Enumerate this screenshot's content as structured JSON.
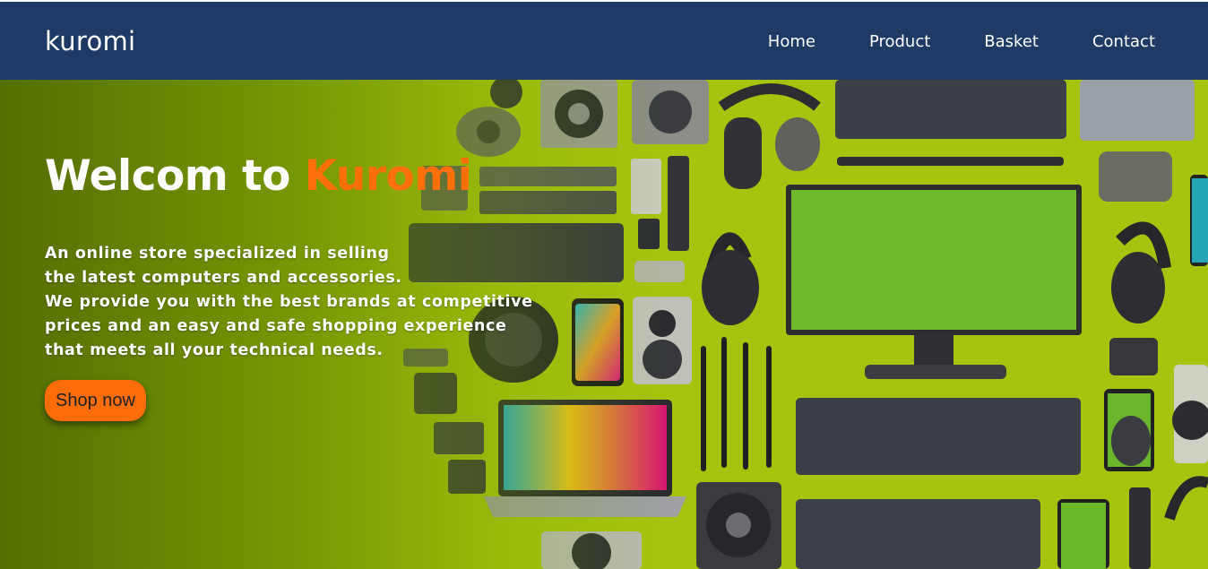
{
  "header": {
    "brand": "kuromi",
    "nav": [
      {
        "label": "Home"
      },
      {
        "label": "Product"
      },
      {
        "label": "Basket"
      },
      {
        "label": "Contact"
      }
    ]
  },
  "hero": {
    "title_prefix": "Welcom to ",
    "title_accent": "Kuromi",
    "description_lines": [
      "An online store specialized in selling",
      "the latest computers and accessories.",
      "We provide you with the best brands at competitive",
      "prices and an easy and safe shopping experience",
      "that meets all your technical needs."
    ],
    "cta_label": "Shop now"
  },
  "colors": {
    "navbar": "#1f3a64",
    "accent": "#ff6f0a",
    "hero_background": "#a9c60f"
  }
}
